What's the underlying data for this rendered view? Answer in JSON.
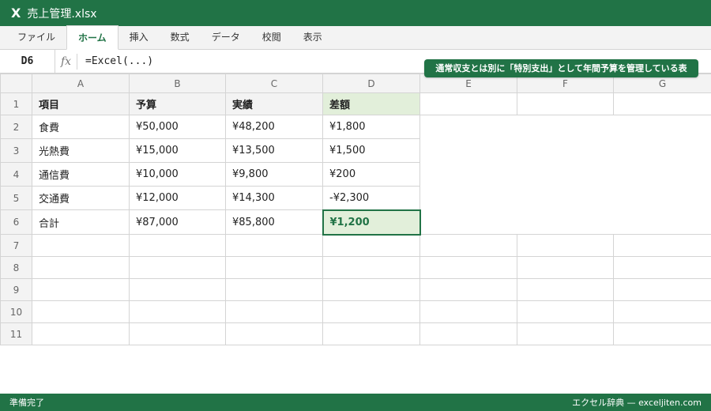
{
  "window": {
    "icon": "excel-logo-icon",
    "icon_glyph": "X",
    "title": "売上管理.xlsx"
  },
  "ribbon": {
    "tabs": [
      "ファイル",
      "ホーム",
      "挿入",
      "数式",
      "データ",
      "校閲",
      "表示"
    ],
    "active_tab": "ホーム"
  },
  "formula_bar": {
    "name_box": "D6",
    "fx_label": "fx",
    "formula": "=Excel(...)"
  },
  "callout": "通常収支とは別に「特別支出」として年間予算を管理している表",
  "columns": [
    "A",
    "B",
    "C",
    "D",
    "E",
    "F",
    "G"
  ],
  "rows": [
    "1",
    "2",
    "3",
    "4",
    "5",
    "6",
    "7",
    "8",
    "9",
    "10",
    "11"
  ],
  "table": {
    "headers": [
      "項目",
      "予算",
      "実績",
      "差額"
    ],
    "data": [
      [
        "食費",
        "¥50,000",
        "¥48,200",
        "¥1,800"
      ],
      [
        "光熱費",
        "¥15,000",
        "¥13,500",
        "¥1,500"
      ],
      [
        "通信費",
        "¥10,000",
        "¥9,800",
        "¥200"
      ],
      [
        "交通費",
        "¥12,000",
        "¥14,300",
        "-¥2,300"
      ],
      [
        "合計",
        "¥87,000",
        "¥85,800",
        "¥1,200"
      ]
    ]
  },
  "status": {
    "left": "準備完了",
    "right": "エクセル辞典 — exceljiten.com"
  },
  "colors": {
    "brand": "#217346",
    "selected_fill": "#e2efda",
    "header_fill": "#f3f3f3",
    "grid": "#d4d4d4"
  }
}
